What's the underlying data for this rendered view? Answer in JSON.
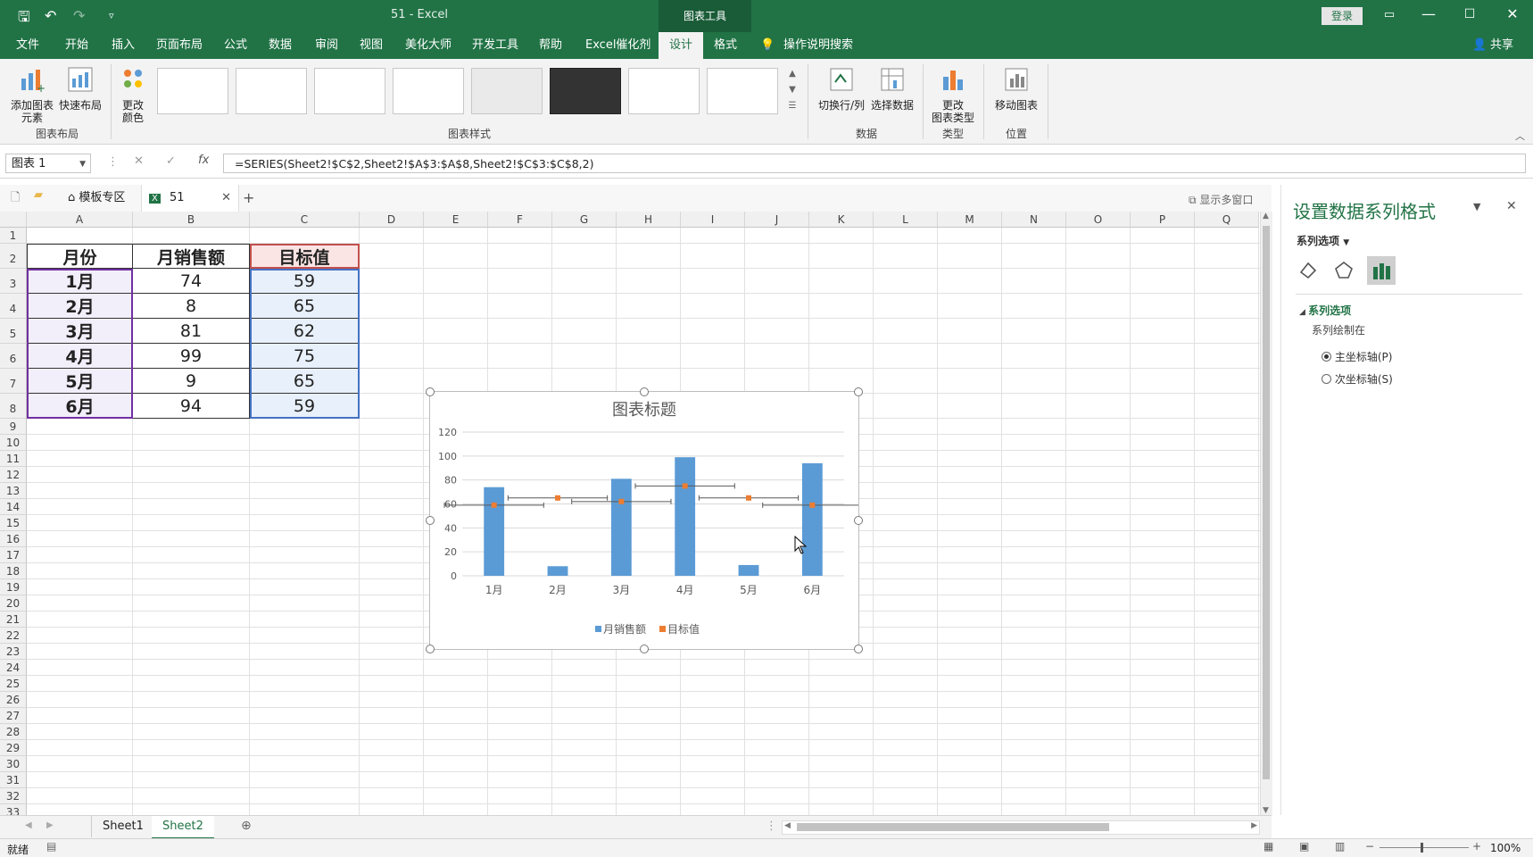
{
  "titlebar": {
    "title": "51  -  Excel",
    "context_tab": "图表工具",
    "login": "登录"
  },
  "tabs": [
    "文件",
    "开始",
    "插入",
    "页面布局",
    "公式",
    "数据",
    "审阅",
    "视图",
    "美化大师",
    "开发工具",
    "帮助",
    "Excel催化剂",
    "设计",
    "格式"
  ],
  "tell_me": "操作说明搜索",
  "share": "共享",
  "ribbon": {
    "add_element": "添加图表\n元素",
    "quick_layout": "快速布局",
    "change_colors": "更改\n颜色",
    "group_layout": "图表布局",
    "group_styles": "图表样式",
    "switch_row_col": "切换行/列",
    "select_data": "选择数据",
    "group_data": "数据",
    "change_type": "更改\n图表类型",
    "group_type": "类型",
    "move_chart": "移动图表",
    "group_location": "位置"
  },
  "formula_bar": {
    "name_box": "图表 1",
    "formula": "=SERIES(Sheet2!$C$2,Sheet2!$A$3:$A$8,Sheet2!$C$3:$C$8,2)",
    "fx": "fx"
  },
  "workbook_tabs": {
    "template": "模板专区",
    "file": "51",
    "multi_window": "显示多窗口"
  },
  "columns": [
    "A",
    "B",
    "C",
    "D",
    "E",
    "F",
    "G",
    "H",
    "I",
    "J",
    "K",
    "L",
    "M",
    "N",
    "O",
    "P",
    "Q"
  ],
  "rows": [
    "1",
    "2",
    "3",
    "4",
    "5",
    "6",
    "7",
    "8",
    "9",
    "10",
    "11",
    "12",
    "13",
    "14",
    "15",
    "16",
    "17",
    "18",
    "19",
    "20",
    "21",
    "22",
    "23",
    "24",
    "25",
    "26",
    "27",
    "28",
    "29",
    "30",
    "31",
    "32",
    "33"
  ],
  "table": {
    "headers": [
      "月份",
      "月销售额",
      "目标值"
    ],
    "rows": [
      [
        "1月",
        "74",
        "59"
      ],
      [
        "2月",
        "8",
        "65"
      ],
      [
        "3月",
        "81",
        "62"
      ],
      [
        "4月",
        "99",
        "75"
      ],
      [
        "5月",
        "9",
        "65"
      ],
      [
        "6月",
        "94",
        "59"
      ]
    ]
  },
  "chart_data": {
    "type": "bar",
    "title": "图表标题",
    "categories": [
      "1月",
      "2月",
      "3月",
      "4月",
      "5月",
      "6月"
    ],
    "series": [
      {
        "name": "月销售额",
        "type": "bar",
        "values": [
          74,
          8,
          81,
          99,
          9,
          94
        ],
        "color": "#5b9bd5"
      },
      {
        "name": "目标值",
        "type": "scatter",
        "values": [
          59,
          65,
          62,
          75,
          65,
          59
        ],
        "color": "#ed7d31",
        "error_bars": "horizontal"
      }
    ],
    "ylim": [
      0,
      120
    ],
    "yticks": [
      "0",
      "20",
      "40",
      "60",
      "80",
      "100",
      "120"
    ],
    "grid": true,
    "legend": "bottom"
  },
  "pane": {
    "title": "设置数据系列格式",
    "options_label": "系列选项",
    "section": "系列选项",
    "plot_on": "系列绘制在",
    "primary": "主坐标轴(P)",
    "secondary": "次坐标轴(S)"
  },
  "sheets": [
    "Sheet1",
    "Sheet2"
  ],
  "status": {
    "ready": "就绪",
    "zoom": "100%"
  },
  "colors": {
    "excel_green": "#217346",
    "bar_blue": "#5b9bd5",
    "target_orange": "#ed7d31"
  }
}
